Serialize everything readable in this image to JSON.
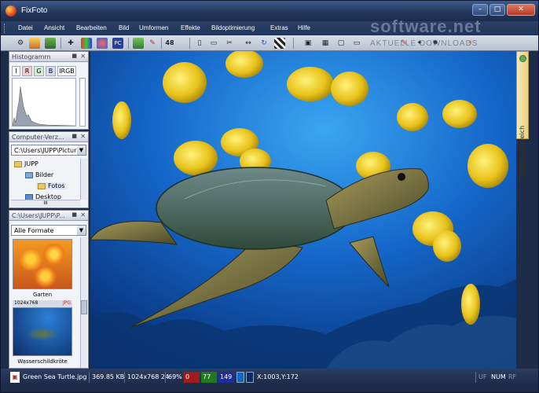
{
  "window": {
    "title": "FixFoto"
  },
  "menu": [
    "Datei",
    "Ansicht",
    "Bearbeiten",
    "Bild",
    "Umformen",
    "Effekte",
    "Bildoptimierung",
    "Extras",
    "Hilfe"
  ],
  "toolbar": {
    "label_48": "48"
  },
  "watermark": {
    "text": "software.net",
    "sub": "AKTUELLE DOWNLOADS"
  },
  "histogram": {
    "title": "Histogramm",
    "tabs": [
      "I",
      "R",
      "G",
      "B",
      "IRGB"
    ]
  },
  "explorer": {
    "title": "Computer-Verz...",
    "path": "C:\\Users\\JUPP\\Pictur",
    "tree": [
      "JUPP",
      "Bilder",
      "Fotos",
      "Desktop"
    ],
    "scroll_label": "III"
  },
  "browser": {
    "title": "C:\\Users\\JUPP\\P...",
    "filter": "Alle Formate",
    "thumbs": [
      {
        "caption": "Garten",
        "info_size": "",
        "info_type": ""
      },
      {
        "caption": "Wasserschildkröte",
        "info_size": "1024x768",
        "info_type": "JPG"
      }
    ]
  },
  "side_tab": {
    "label": "Aufgabenbereich"
  },
  "status": {
    "filename": "Green Sea Turtle.jpg",
    "filesize": "369.85 KB",
    "dimensions": "1024x768 24",
    "zoom": "69%",
    "r": "0",
    "g": "77",
    "b": "149",
    "coords": "X:1003,Y:172",
    "uf": "UF",
    "num": "NUM",
    "rf": "RF"
  },
  "colors": {
    "r_cell": "#a01c1c",
    "g_cell": "#1f7a1f",
    "b_cell": "#1c2e9a"
  }
}
